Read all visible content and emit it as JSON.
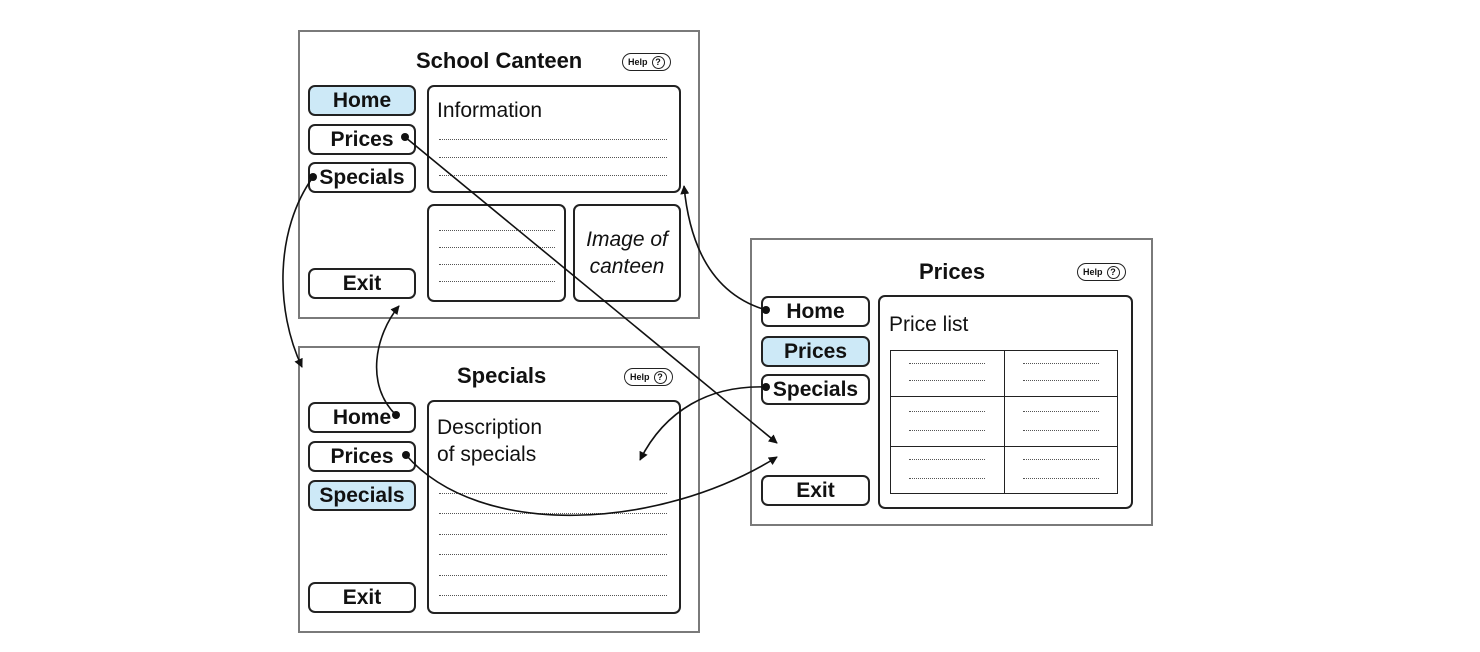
{
  "home_screen": {
    "title": "School Canteen",
    "help_label": "Help",
    "help_symbol": "?",
    "nav": {
      "home": "Home",
      "prices": "Prices",
      "specials": "Specials",
      "exit": "Exit"
    },
    "info_heading": "Information",
    "image_label_line1": "Image of",
    "image_label_line2": "canteen"
  },
  "specials_screen": {
    "title": "Specials",
    "help_label": "Help",
    "help_symbol": "?",
    "nav": {
      "home": "Home",
      "prices": "Prices",
      "specials": "Specials",
      "exit": "Exit"
    },
    "description_line1": "Description",
    "description_line2": "of specials"
  },
  "prices_screen": {
    "title": "Prices",
    "help_label": "Help",
    "help_symbol": "?",
    "nav": {
      "home": "Home",
      "prices": "Prices",
      "specials": "Specials",
      "exit": "Exit"
    },
    "price_list_heading": "Price list"
  },
  "colors": {
    "active_button": "#cde9f7",
    "frame_border": "#7a7a7a",
    "line": "#111111"
  }
}
